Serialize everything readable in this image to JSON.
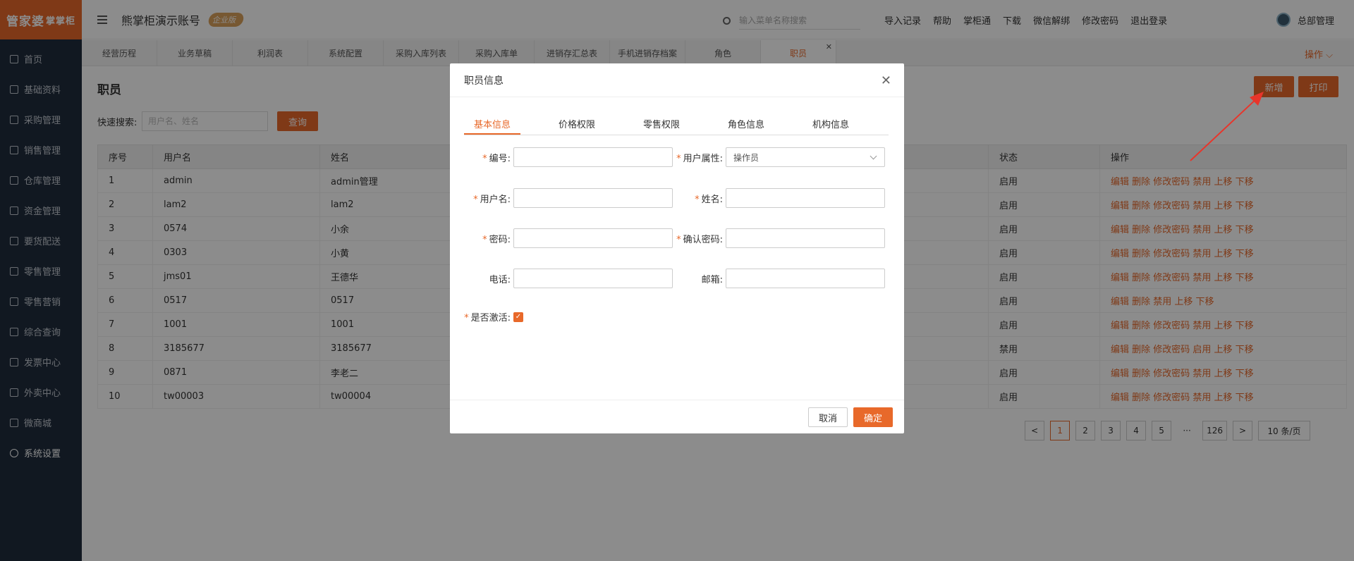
{
  "logo": {
    "main": "管家婆",
    "sub": "掌掌柜"
  },
  "sidebar": {
    "items": [
      {
        "label": "首页",
        "icon": "globe-icon"
      },
      {
        "label": "基础资料",
        "icon": "home-icon"
      },
      {
        "label": "采购管理",
        "icon": "cart-icon"
      },
      {
        "label": "销售管理",
        "icon": "sales-icon"
      },
      {
        "label": "仓库管理",
        "icon": "warehouse-icon"
      },
      {
        "label": "资金管理",
        "icon": "money-icon"
      },
      {
        "label": "要货配送",
        "icon": "delivery-icon"
      },
      {
        "label": "零售管理",
        "icon": "chart-icon"
      },
      {
        "label": "零售营销",
        "icon": "gift-icon"
      },
      {
        "label": "综合查询",
        "icon": "stats-icon"
      },
      {
        "label": "发票中心",
        "icon": "invoice-icon"
      },
      {
        "label": "外卖中心",
        "icon": "takeout-icon"
      },
      {
        "label": "微商城",
        "icon": "bag-icon"
      },
      {
        "label": "系统设置",
        "icon": "gear-icon"
      }
    ]
  },
  "header": {
    "account": "熊掌柜演示账号",
    "badge": "企业版",
    "search_placeholder": "输入菜单名称搜索",
    "links": [
      "导入记录",
      "帮助",
      "掌柜通",
      "下载",
      "微信解绑",
      "修改密码",
      "退出登录"
    ],
    "user": "总部管理"
  },
  "tabs": [
    "经营历程",
    "业务草稿",
    "利润表",
    "系统配置",
    "采购入库列表",
    "采购入库单",
    "进销存汇总表",
    "手机进销存档案",
    "角色",
    "职员"
  ],
  "ops_label": "操作",
  "page": {
    "title": "职员",
    "add_label": "新增",
    "print_label": "打印",
    "quick_search_label": "快速搜索:",
    "quick_search_placeholder": "用户名、姓名",
    "query_label": "查询"
  },
  "table": {
    "columns": [
      "序号",
      "用户名",
      "姓名",
      "状态",
      "操作"
    ],
    "rows": [
      {
        "no": "1",
        "user": "admin",
        "name": "admin管理",
        "status": "启用",
        "actions": "编辑 删除 修改密码 禁用 上移 下移"
      },
      {
        "no": "2",
        "user": "lam2",
        "name": "lam2",
        "status": "启用",
        "actions": "编辑 删除 修改密码 禁用 上移 下移"
      },
      {
        "no": "3",
        "user": "0574",
        "name": "小余",
        "status": "启用",
        "actions": "编辑 删除 修改密码 禁用 上移 下移"
      },
      {
        "no": "4",
        "user": "0303",
        "name": "小黄",
        "status": "启用",
        "actions": "编辑 删除 修改密码 禁用 上移 下移"
      },
      {
        "no": "5",
        "user": "jms01",
        "name": "王德华",
        "status": "启用",
        "actions": "编辑 删除 修改密码 禁用 上移 下移"
      },
      {
        "no": "6",
        "user": "0517",
        "name": "0517",
        "status": "启用",
        "actions": "编辑 删除 禁用 上移 下移"
      },
      {
        "no": "7",
        "user": "1001",
        "name": "1001",
        "status": "启用",
        "actions": "编辑 删除 修改密码 禁用 上移 下移"
      },
      {
        "no": "8",
        "user": "3185677",
        "name": "3185677",
        "status": "禁用",
        "actions": "编辑 删除 修改密码 启用 上移 下移"
      },
      {
        "no": "9",
        "user": "0871",
        "name": "李老二",
        "status": "启用",
        "actions": "编辑 删除 修改密码 禁用 上移 下移"
      },
      {
        "no": "10",
        "user": "tw00003",
        "name": "tw00004",
        "status": "启用",
        "actions": "编辑 删除 修改密码 禁用 上移 下移"
      }
    ]
  },
  "pager": {
    "pages": [
      "1",
      "2",
      "3",
      "4",
      "5"
    ],
    "ellipsis": "···",
    "last": "126",
    "prev": "<",
    "next": ">",
    "size": "10 条/页"
  },
  "dialog": {
    "title": "职员信息",
    "tabs": [
      "基本信息",
      "价格权限",
      "零售权限",
      "角色信息",
      "机构信息"
    ],
    "fields": {
      "code": "编号:",
      "attr": "用户属性:",
      "attr_value": "操作员",
      "username": "用户名:",
      "name": "姓名:",
      "password": "密码:",
      "confirm": "确认密码:",
      "phone": "电话:",
      "email": "邮箱:",
      "active": "是否激活:"
    },
    "required_mark": "*",
    "cancel_label": "取消",
    "ok_label": "确定"
  },
  "colors": {
    "accent": "#e8692a",
    "sidebar": "#1f2d3d",
    "arrow": "#e8352b"
  }
}
